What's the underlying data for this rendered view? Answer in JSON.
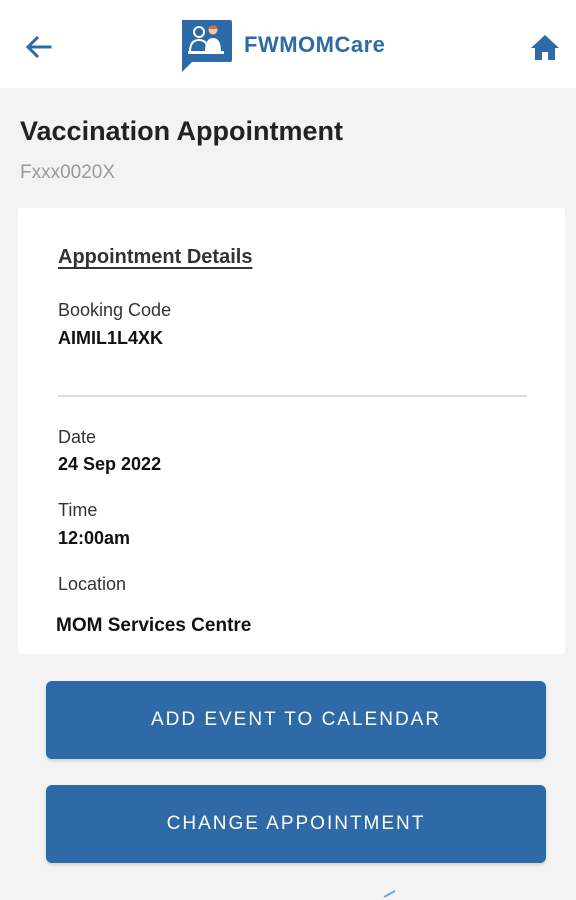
{
  "header": {
    "back_icon": "arrow-left-icon",
    "app_name": "FWMOMCare",
    "logo_icon": "fwmomcare-logo-icon",
    "home_icon": "home-icon",
    "brand_color": "#2e6aa7"
  },
  "page": {
    "title": "Vaccination Appointment",
    "subtitle": "Fxxx0020X"
  },
  "details": {
    "heading": "Appointment Details",
    "booking_code_label": "Booking Code",
    "booking_code_value": "AIMIL1L4XK",
    "date_label": "Date",
    "date_value": "24 Sep 2022",
    "time_label": "Time",
    "time_value": "12:00am",
    "location_label": "Location",
    "location_value": "MOM Services Centre"
  },
  "actions": {
    "add_to_calendar_label": "ADD EVENT TO CALENDAR",
    "change_appointment_label": "CHANGE APPOINTMENT"
  }
}
